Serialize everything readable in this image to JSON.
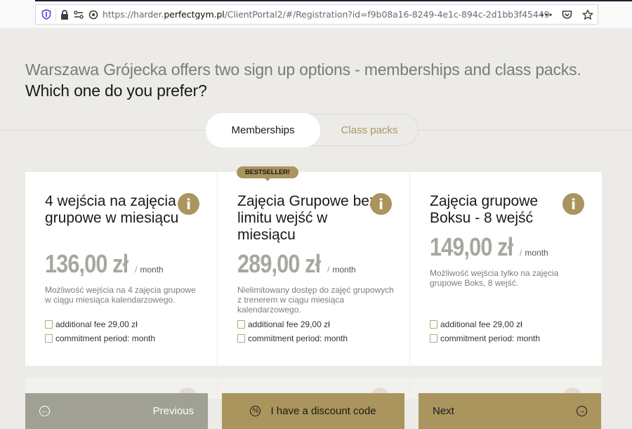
{
  "browser": {
    "url_prefix": "https://harder.",
    "url_domain": "perfectgym.pl",
    "url_path": "/ClientPortal2/#/Registration?id=f9b08a16-8249-4e1c-894c-2d1bb3f45449",
    "icons": [
      "shield-icon",
      "lock-icon",
      "permissions-icon",
      "tracking-icon",
      "more-icon",
      "pocket-icon",
      "bookmark-star-icon"
    ]
  },
  "headline": {
    "line1": "Warszawa Grójecka offers two sign up options - memberships and class packs.",
    "line2": "Which one do you prefer?"
  },
  "tabs": [
    {
      "label": "Memberships",
      "active": true
    },
    {
      "label": "Class packs",
      "active": false
    }
  ],
  "badge": "BESTSELLER!",
  "cards": [
    {
      "title": "4 wejścia na zajęcia grupowe w miesiącu",
      "price": "136,00 zł",
      "per_slash": "/",
      "period": "month",
      "description": "Możliwość wejścia na 4 zajęcia grupowe w ciągu miesiąca kalendarzowego.",
      "fee": "additional fee 29,00 zł",
      "commitment": "commitment period: month"
    },
    {
      "title": "Zajęcia Grupowe bez limitu wejść w miesiącu",
      "price": "289,00 zł",
      "per_slash": "/",
      "period": "month",
      "description": "Nielimitowany dostęp do zajęć grupowych z trenerem w ciągu miesiąca kalendarzowego.",
      "fee": "additional fee 29,00 zł",
      "commitment": "commitment period: month"
    },
    {
      "title": "Zajęcia grupowe Boksu - 8 wejść",
      "price": "149,00 zł",
      "per_slash": "/",
      "period": "month",
      "description": "Możliwość wejścia tylko na zajęcia grupowe Boks, 8 wejść.",
      "fee": "additional fee 29,00 zł",
      "commitment": "commitment period: month"
    }
  ],
  "info_glyph": "i",
  "buttons": {
    "previous": "Previous",
    "discount": "I have a discount code",
    "next": "Next"
  },
  "colors": {
    "accent": "#a9955d",
    "previous_bg": "#a0a095",
    "price": "#a8a79f",
    "background": "#ecebe7"
  }
}
